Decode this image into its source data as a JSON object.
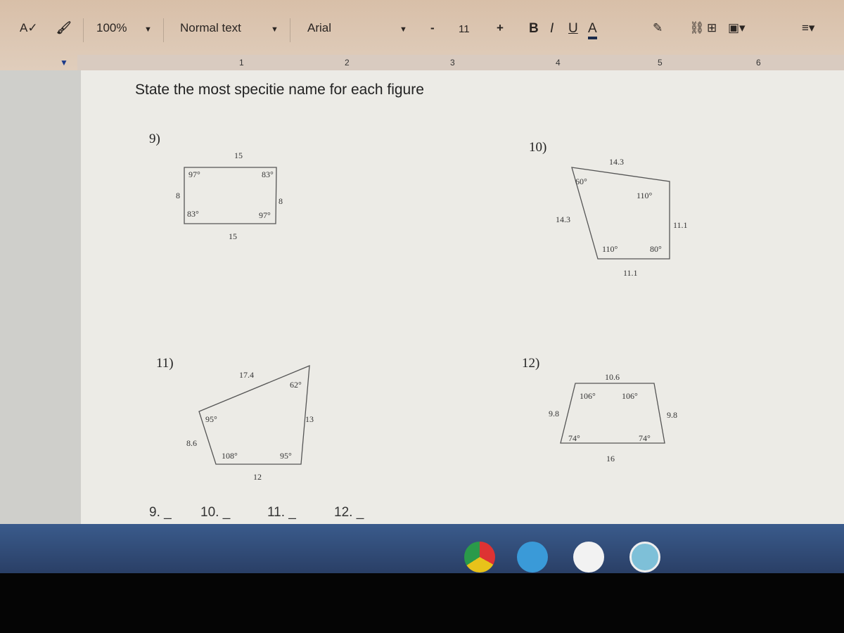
{
  "toolbar": {
    "zoom": "100%",
    "style": "Normal text",
    "font": "Arial",
    "font_size": "11",
    "minus": "-",
    "plus": "+",
    "bold": "B",
    "italic": "I",
    "underline": "U",
    "text_color": "A",
    "text_color_hex": "#1a2a4a"
  },
  "ruler": {
    "marks": [
      "1",
      "2",
      "3",
      "4",
      "5",
      "6"
    ]
  },
  "document": {
    "instruction": "State the most specitie name for each figure",
    "figures": [
      {
        "number": "9)",
        "labels": [
          "15",
          "97°",
          "83°",
          "8",
          "8",
          "83°",
          "97°",
          "15"
        ]
      },
      {
        "number": "10)",
        "labels": [
          "14.3",
          "60°",
          "110°",
          "14.3",
          "11.1",
          "110°",
          "80°",
          "11.1"
        ]
      },
      {
        "number": "11)",
        "labels": [
          "17.4",
          "62°",
          "95°",
          "13",
          "8.6",
          "108°",
          "95°",
          "12"
        ]
      },
      {
        "number": "12)",
        "labels": [
          "10.6",
          "106°",
          "106°",
          "9.8",
          "9.8",
          "74°",
          "74°",
          "16"
        ]
      }
    ],
    "answers": [
      "9. _",
      "10. _",
      "11. _",
      "12. _"
    ]
  },
  "taskbar": {
    "icons": [
      "chrome-icon",
      "app-icon",
      "app-icon",
      "clock-icon"
    ]
  }
}
